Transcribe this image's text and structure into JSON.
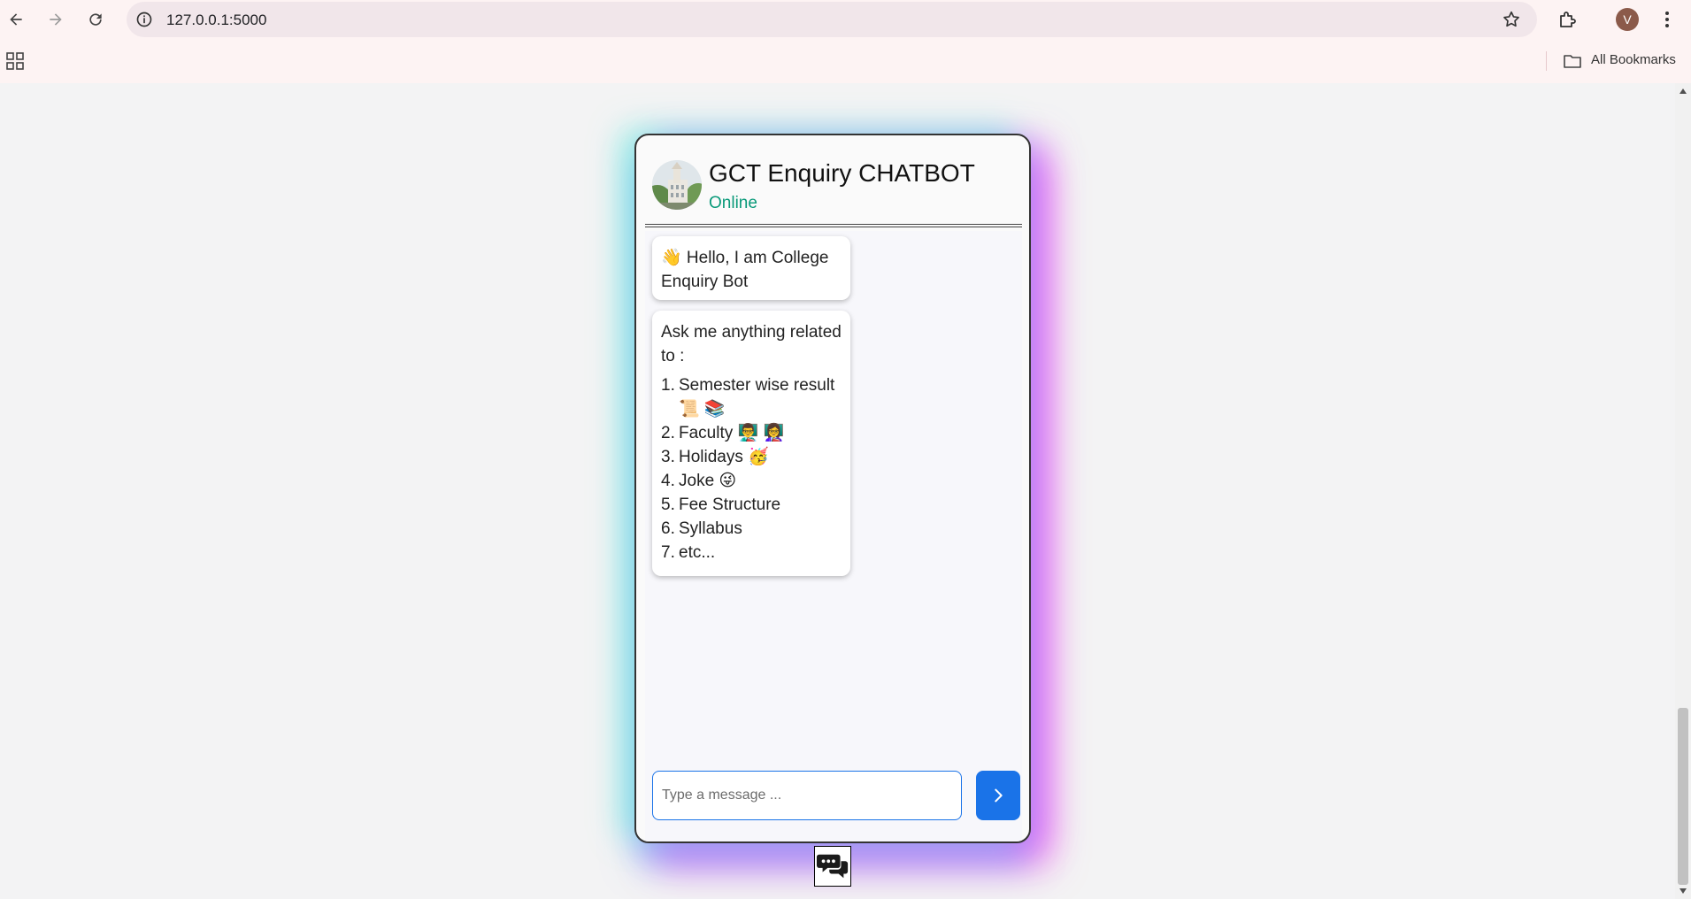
{
  "browser": {
    "url": "127.0.0.1:5000",
    "profile_initial": "V",
    "bookmarks_label": "All Bookmarks"
  },
  "chat": {
    "title": "GCT Enquiry CHATBOT",
    "status": "Online",
    "messages": {
      "greeting": "👋 Hello, I am College Enquiry Bot",
      "intro": "Ask me anything related to :",
      "topics": [
        {
          "num": "1.",
          "text": "Semester wise result 📜 📚"
        },
        {
          "num": "2.",
          "text": "Faculty 👨‍🏫 👩‍🏫"
        },
        {
          "num": "3.",
          "text": "Holidays 🥳"
        },
        {
          "num": "4.",
          "text": "Joke 😜"
        },
        {
          "num": "5.",
          "text": "Fee Structure"
        },
        {
          "num": "6.",
          "text": "Syllabus"
        },
        {
          "num": "7.",
          "text": "etc..."
        }
      ]
    },
    "input_placeholder": "Type a message ..."
  },
  "colors": {
    "accent": "#1a73e8",
    "online": "#0a9a7a"
  }
}
